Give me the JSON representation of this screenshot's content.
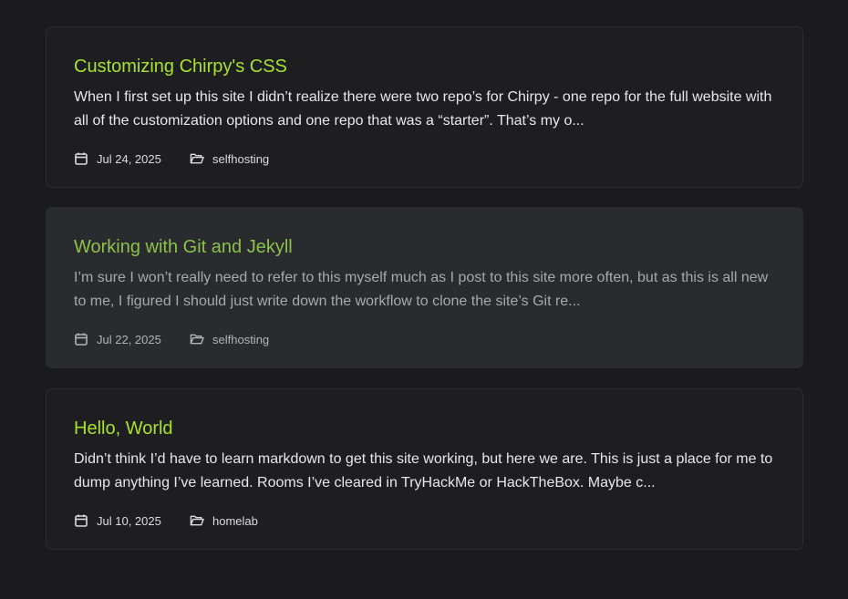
{
  "theme": {
    "background": "#1b1b1e",
    "card_background": "#1e1e20",
    "card_hover_background": "#2a2b2e",
    "title_color": "#a7e22e",
    "title_hover_color": "#8bc24a",
    "text_color": "#e8e8e8"
  },
  "posts": [
    {
      "title": "Customizing Chirpy's CSS",
      "excerpt": "When I first set up this site I didn’t realize there were two repo’s for Chirpy - one repo for the full website with all of the customization options and one repo that was a “starter”. That’s my o...",
      "date": "Jul 24, 2025",
      "category": "selfhosting",
      "hovered": false
    },
    {
      "title": "Working with Git and Jekyll",
      "excerpt": "I’m sure I won’t really need to refer to this myself much as I post to this site more often, but as this is all new to me, I figured I should just write down the workflow to clone the site’s Git re...",
      "date": "Jul 22, 2025",
      "category": "selfhosting",
      "hovered": true
    },
    {
      "title": "Hello, World",
      "excerpt": "Didn’t think I’d have to learn markdown to get this site working, but here we are. This is just a place for me to dump anything I’ve learned. Rooms I’ve cleared in TryHackMe or HackTheBox. Maybe c...",
      "date": "Jul 10, 2025",
      "category": "homelab",
      "hovered": false
    }
  ],
  "icons": {
    "date": "calendar-icon",
    "category": "folder-open-icon"
  }
}
